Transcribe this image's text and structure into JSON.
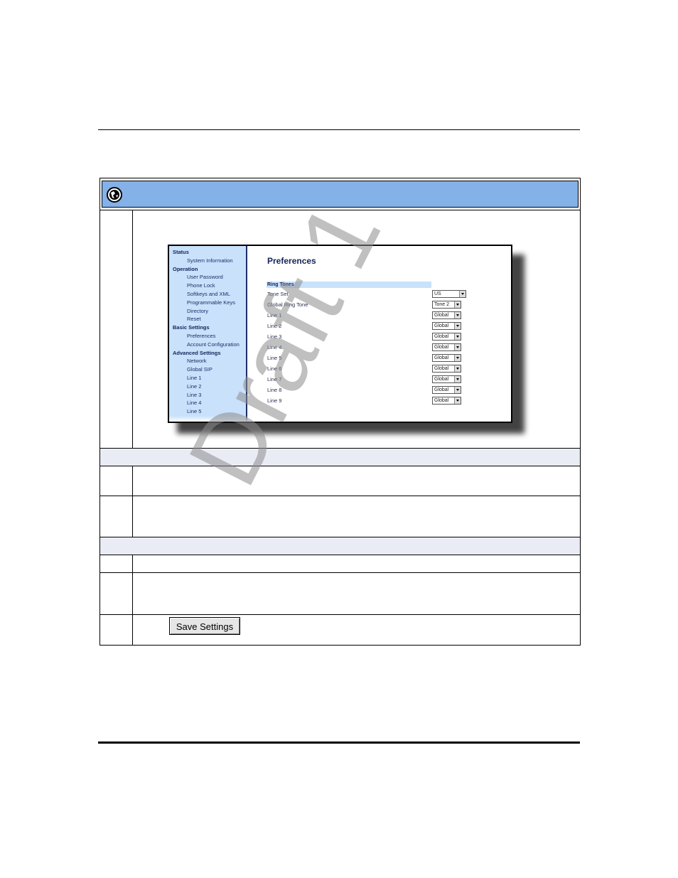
{
  "figure": {
    "page_title": "Preferences",
    "nav": [
      {
        "label": "Status",
        "level": "head"
      },
      {
        "label": "System Information",
        "level": "sub"
      },
      {
        "label": "Operation",
        "level": "head"
      },
      {
        "label": "User Password",
        "level": "sub"
      },
      {
        "label": "Phone Lock",
        "level": "sub"
      },
      {
        "label": "Softkeys and XML",
        "level": "sub"
      },
      {
        "label": "Programmable Keys",
        "level": "sub"
      },
      {
        "label": "Directory",
        "level": "sub"
      },
      {
        "label": "Reset",
        "level": "sub"
      },
      {
        "label": "Basic Settings",
        "level": "head"
      },
      {
        "label": "Preferences",
        "level": "sub"
      },
      {
        "label": "Account Configuration",
        "level": "sub"
      },
      {
        "label": "Advanced Settings",
        "level": "head"
      },
      {
        "label": "Network",
        "level": "sub"
      },
      {
        "label": "Global SIP",
        "level": "sub"
      },
      {
        "label": "Line 1",
        "level": "sub"
      },
      {
        "label": "Line 2",
        "level": "sub"
      },
      {
        "label": "Line 3",
        "level": "sub"
      },
      {
        "label": "Line 4",
        "level": "sub"
      },
      {
        "label": "Line 5",
        "level": "sub"
      }
    ],
    "ring_tones_heading": "Ring Tones",
    "settings": [
      {
        "label": "Tone Set",
        "value": "US"
      },
      {
        "label": "Global Ring Tone",
        "value": "Tone 2"
      },
      {
        "label": "Line 1",
        "value": "Global"
      },
      {
        "label": "Line 2",
        "value": "Global"
      },
      {
        "label": "Line 3",
        "value": "Global"
      },
      {
        "label": "Line 4",
        "value": "Global"
      },
      {
        "label": "Line 5",
        "value": "Global"
      },
      {
        "label": "Line 6",
        "value": "Global"
      },
      {
        "label": "Line 7",
        "value": "Global"
      },
      {
        "label": "Line 8",
        "value": "Global"
      },
      {
        "label": "Line 9",
        "value": "Global"
      }
    ]
  },
  "save_button_label": "Save Settings",
  "watermark": "Draft 1",
  "colors": {
    "header_bar": "#83b1e8",
    "nav_background": "#c9e1fb",
    "section_row": "#e9ecf5"
  }
}
